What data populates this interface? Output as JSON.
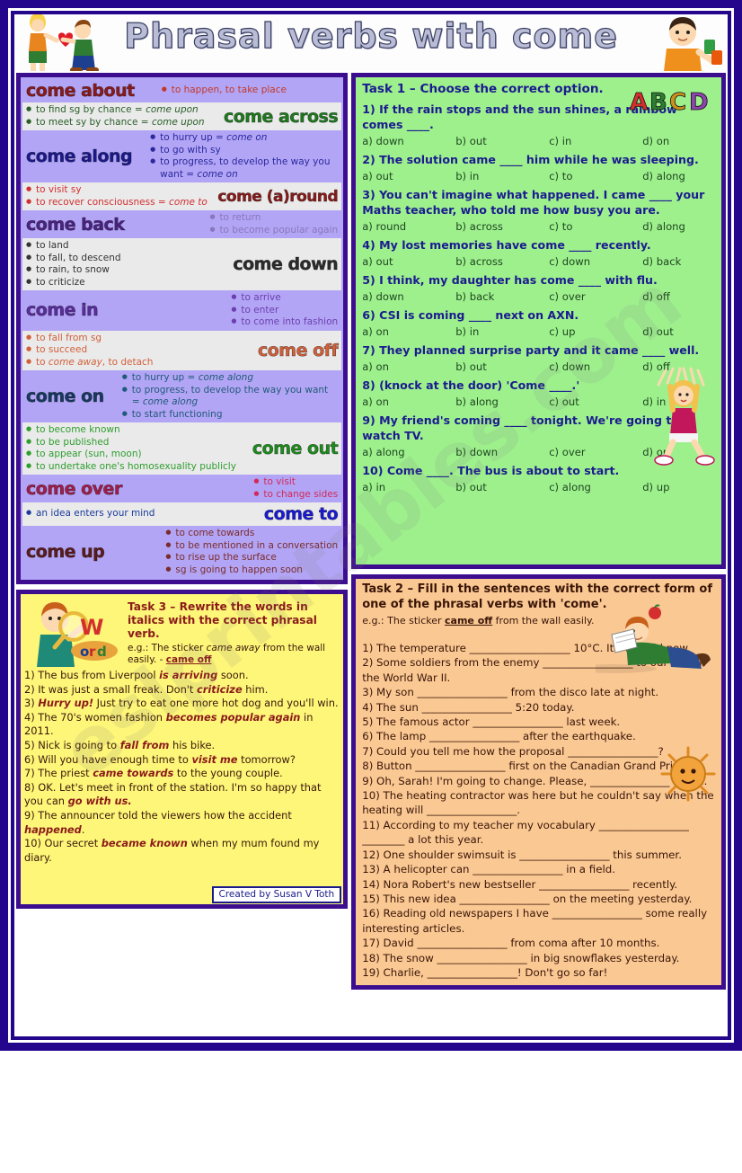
{
  "header": {
    "title": "Phrasal verbs with come",
    "left_image": "couple-with-heart-clipart",
    "right_image": "boy-with-abcd-letters-clipart"
  },
  "watermark": "eslprintables.com",
  "vocabulary": {
    "rows": [
      {
        "verb": "come about",
        "verb_color": "#8b1a1a",
        "layout": "head-left-inline",
        "bg": "lav",
        "bullet_color": "#c0392b",
        "text_color": "#c0392b",
        "defs": [
          "to happen, to take place"
        ]
      },
      {
        "verb": "come across",
        "verb_color": "#1d7a1d",
        "layout": "head-right",
        "bg": "alt",
        "bullet_color": "#2e8b2e",
        "text_color": "#2a5e2a",
        "defs": [
          "to find sg by chance = <i>come upon</i>",
          "to meet sy by chance = <i>come upon</i>"
        ]
      },
      {
        "verb": "come along",
        "verb_color": "#1a1a8c",
        "layout": "head-left",
        "bg": "lav",
        "bullet_color": "#2a2a9e",
        "text_color": "#2a2a9e",
        "defs": [
          "to hurry up = <i>come on</i>",
          "to go with sy",
          "to progress, to develop the way you want = <i>come on</i>"
        ]
      },
      {
        "verb": "come (a)round",
        "verb_color": "#8b1a1a",
        "layout": "head-right",
        "bg": "alt",
        "bullet_color": "#d13030",
        "text_color": "#d13030",
        "defs": [
          "to visit sy",
          "to recover consciousness = <i>come to</i>"
        ]
      },
      {
        "verb": "come back",
        "verb_color": "#4b2382",
        "layout": "head-left",
        "bg": "lav",
        "bullet_color": "#8877bb",
        "text_color": "#8877bb",
        "defs": [
          "to return",
          "to become popular again"
        ]
      },
      {
        "verb": "come down",
        "verb_color": "#2b2b2b",
        "layout": "head-right",
        "bg": "alt",
        "bullet_color": "#444444",
        "text_color": "#333333",
        "defs": [
          "to land",
          "to fall, to descend",
          "to rain, to snow",
          "to criticize"
        ]
      },
      {
        "verb": "come in",
        "verb_color": "#5a2d9e",
        "layout": "head-left",
        "bg": "lav",
        "bullet_color": "#6b3fb0",
        "text_color": "#6b3fb0",
        "defs": [
          "to arrive",
          "to enter",
          "to come into fashion"
        ]
      },
      {
        "verb": "come off",
        "verb_color": "#d2603a",
        "layout": "head-right",
        "bg": "alt",
        "bullet_color": "#d2603a",
        "text_color": "#d2603a",
        "defs": [
          "to fall from sg",
          "to succeed",
          "to <i>come away</i>, to detach"
        ]
      },
      {
        "verb": "come on",
        "verb_color": "#163a5f",
        "layout": "head-left",
        "bg": "lav",
        "bullet_color": "#1f5a7a",
        "text_color": "#1f5a7a",
        "defs": [
          "to hurry up = <i>come along</i>",
          "to progress, to develop the way you want = <i>come along</i>",
          "to start functioning"
        ]
      },
      {
        "verb": "come out",
        "verb_color": "#1d8c1d",
        "layout": "head-right",
        "bg": "alt",
        "bullet_color": "#2e9e2e",
        "text_color": "#2e9e2e",
        "defs": [
          "to become known",
          "to be published",
          "to appear (sun, moon)",
          "to undertake one's homosexuality publicly"
        ]
      },
      {
        "verb": "come over",
        "verb_color": "#a31d4a",
        "layout": "head-left",
        "bg": "lav",
        "bullet_color": "#d12a5c",
        "text_color": "#d12a5c",
        "defs": [
          "to visit",
          "to change sides"
        ]
      },
      {
        "verb": "come to",
        "verb_color": "#1a1ad6",
        "layout": "head-right",
        "bg": "alt",
        "bullet_color": "#1a1ad6",
        "text_color": "#1a3a9e",
        "defs": [
          "an idea enters your mind"
        ]
      },
      {
        "verb": "come up",
        "verb_color": "#5c1b1b",
        "layout": "head-left",
        "bg": "lav",
        "bullet_color": "#8b2b2b",
        "text_color": "#7a2b2b",
        "defs": [
          "to come towards",
          "to be mentioned in a conversation",
          "to rise up the surface",
          "sg is going to happen soon"
        ]
      }
    ]
  },
  "task1": {
    "title": "Task 1 – Choose the correct option.",
    "decor_image": "abcd-letters-icon",
    "side_image": "girl-cheering-clipart",
    "questions": [
      {
        "text": "1) If the rain stops and the sun shines, a rainbow comes ____.",
        "options": [
          "a) down",
          "b) out",
          "c) in",
          "d) on"
        ]
      },
      {
        "text": "2) The solution came ____ him while he was sleeping.",
        "options": [
          "a) out",
          "b) in",
          "c) to",
          "d) along"
        ]
      },
      {
        "text": "3) You can't imagine what happened. I came ____ your Maths teacher, who told me how busy you are.",
        "options": [
          "a) round",
          "b) across",
          "c) to",
          "d) along"
        ]
      },
      {
        "text": "4) My lost memories have come ____ recently.",
        "options": [
          "a) out",
          "b) across",
          "c) down",
          "d) back"
        ]
      },
      {
        "text": "5) I think, my daughter has come ____ with flu.",
        "options": [
          "a) down",
          "b) back",
          "c) over",
          "d) off"
        ]
      },
      {
        "text": "6) CSI is coming ____ next on AXN.",
        "options": [
          "a) on",
          "b) in",
          "c) up",
          "d) out"
        ]
      },
      {
        "text": "7) They planned surprise party and it came ____ well.",
        "options": [
          "a) on",
          "b) out",
          "c) down",
          "d) off"
        ]
      },
      {
        "text": "8) (knock at the door) 'Come ____.'",
        "options": [
          "a) on",
          "b) along",
          "c) out",
          "d) in"
        ]
      },
      {
        "text": "9) My friend's coming ____ tonight. We're going to watch TV.",
        "options": [
          "a) along",
          "b) down",
          "c) over",
          "d) on"
        ]
      },
      {
        "text": "10) Come ____. The bus is about to start.",
        "options": [
          "a) in",
          "b) out",
          "c) along",
          "d) up"
        ]
      }
    ]
  },
  "task2": {
    "title": "Task 2 – Fill in the sentences with the correct form of one of the phrasal verbs with 'come'.",
    "example_prefix": "e.g.: The sticker ",
    "example_bold": "came off",
    "example_suffix": " from the wall easily.",
    "decor_image_1": "boy-reading-lying-down-clipart",
    "decor_image_2": "sun-face-clipart",
    "items": [
      "1) The temperature ___________________ 10°C. It's so cold now.",
      "2) Some soldiers from the enemy _________________ to our side in the World War II.",
      "3) My son _________________ from the disco late at night.",
      "4) The sun _________________ 5:20 today.",
      "5) The famous actor _________________ last week.",
      "6) The lamp _________________ after the earthquake.",
      "7) Could you tell me how the proposal _________________?",
      "8) Button _________________ first on the Canadian Grand Prix.",
      "9) Oh, Sarah! I'm going to change. Please, _______________ to me.",
      "10) The heating contractor was here but he couldn't say when the heating will _________________.",
      "11) According to my teacher my vocabulary _________________ ________ a lot this year.",
      "12) One shoulder swimsuit is _________________ this summer.",
      "13) A helicopter can _________________ in a field.",
      "14) Nora Robert's new bestseller _________________ recently.",
      "15) This new idea _________________ on the meeting yesterday.",
      "16) Reading old newspapers I have _________________ some really interesting articles.",
      "17) David _________________ from coma after 10 months.",
      "18) The snow _________________ in big snowflakes yesterday.",
      "19) Charlie, _________________! Don't go so far!"
    ]
  },
  "task3": {
    "title": "Task 3 – Rewrite the words in italics with the correct phrasal verb.",
    "example": "e.g.: The sticker <i>came away</i> from the wall easily. - <u><b>came off</b></u>",
    "decor_image": "boy-with-magnifying-glass-clipart",
    "items": [
      "1) The bus from Liverpool <i>is arriving</i> soon.",
      "2) It was just a small freak. Don't <i>criticize</i> him.",
      "3) <i>Hurry up!</i> Just try to eat one more hot dog and you'll win.",
      "4) The 70's women fashion <i>becomes popular again</i> in 2011.",
      "5) Nick is going to <i>fall from</i> his bike.",
      "6) Will you have enough time to <i>visit me</i> tomorrow?",
      "7) The priest <i>came towards</i> to the young couple.",
      "8) OK. Let's meet in front of the station. I'm so happy that you can <i>go with us.</i>",
      "9) The announcer told the viewers how the accident <i>happened</i>.",
      "10) Our secret <i>became known</i> when my mum found my diary."
    ],
    "credit": "Created by Susan V Toth"
  },
  "colors": {
    "frame": "#23068c",
    "box_border": "#3d0d8f",
    "vocab_lavender": "#b3a5f5",
    "vocab_grey": "#eaeaea",
    "task1_green": "#9ef08d",
    "task2_orange": "#fac893",
    "task3_yellow": "#fdf679"
  }
}
